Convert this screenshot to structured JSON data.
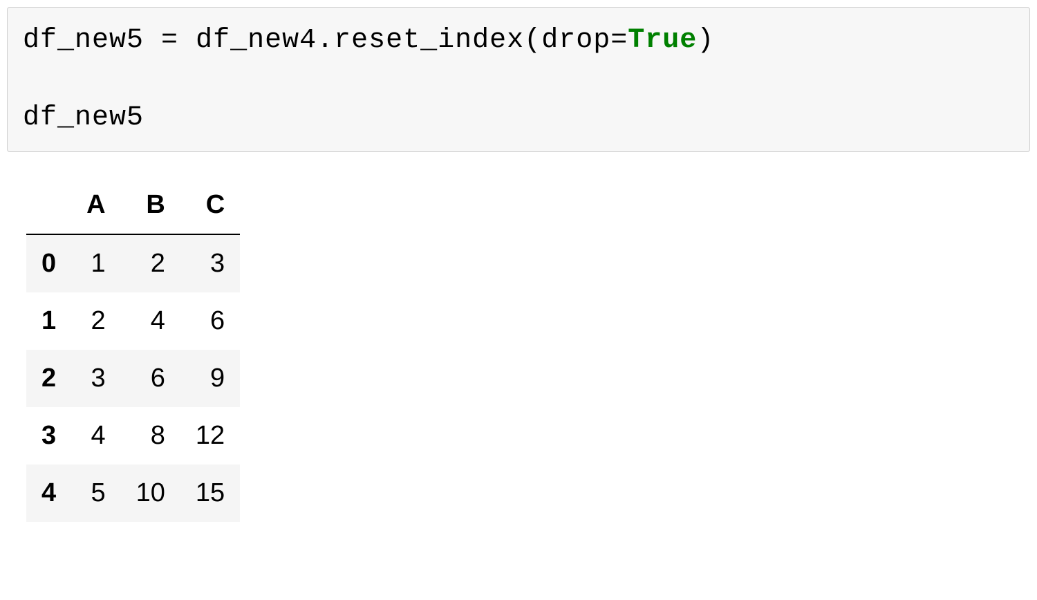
{
  "code": {
    "var_out": "df_new5",
    "space": " ",
    "equals": "=",
    "var_in": "df_new4",
    "dot": ".",
    "method": "reset_index",
    "lparen": "(",
    "kw_arg": "drop",
    "kw_eq": "=",
    "kw_true": "True",
    "rparen": ")",
    "line3": "df_new5"
  },
  "table": {
    "headers": [
      "A",
      "B",
      "C"
    ],
    "index": [
      "0",
      "1",
      "2",
      "3",
      "4"
    ],
    "rows": [
      [
        "1",
        "2",
        "3"
      ],
      [
        "2",
        "4",
        "6"
      ],
      [
        "3",
        "6",
        "9"
      ],
      [
        "4",
        "8",
        "12"
      ],
      [
        "5",
        "10",
        "15"
      ]
    ]
  }
}
